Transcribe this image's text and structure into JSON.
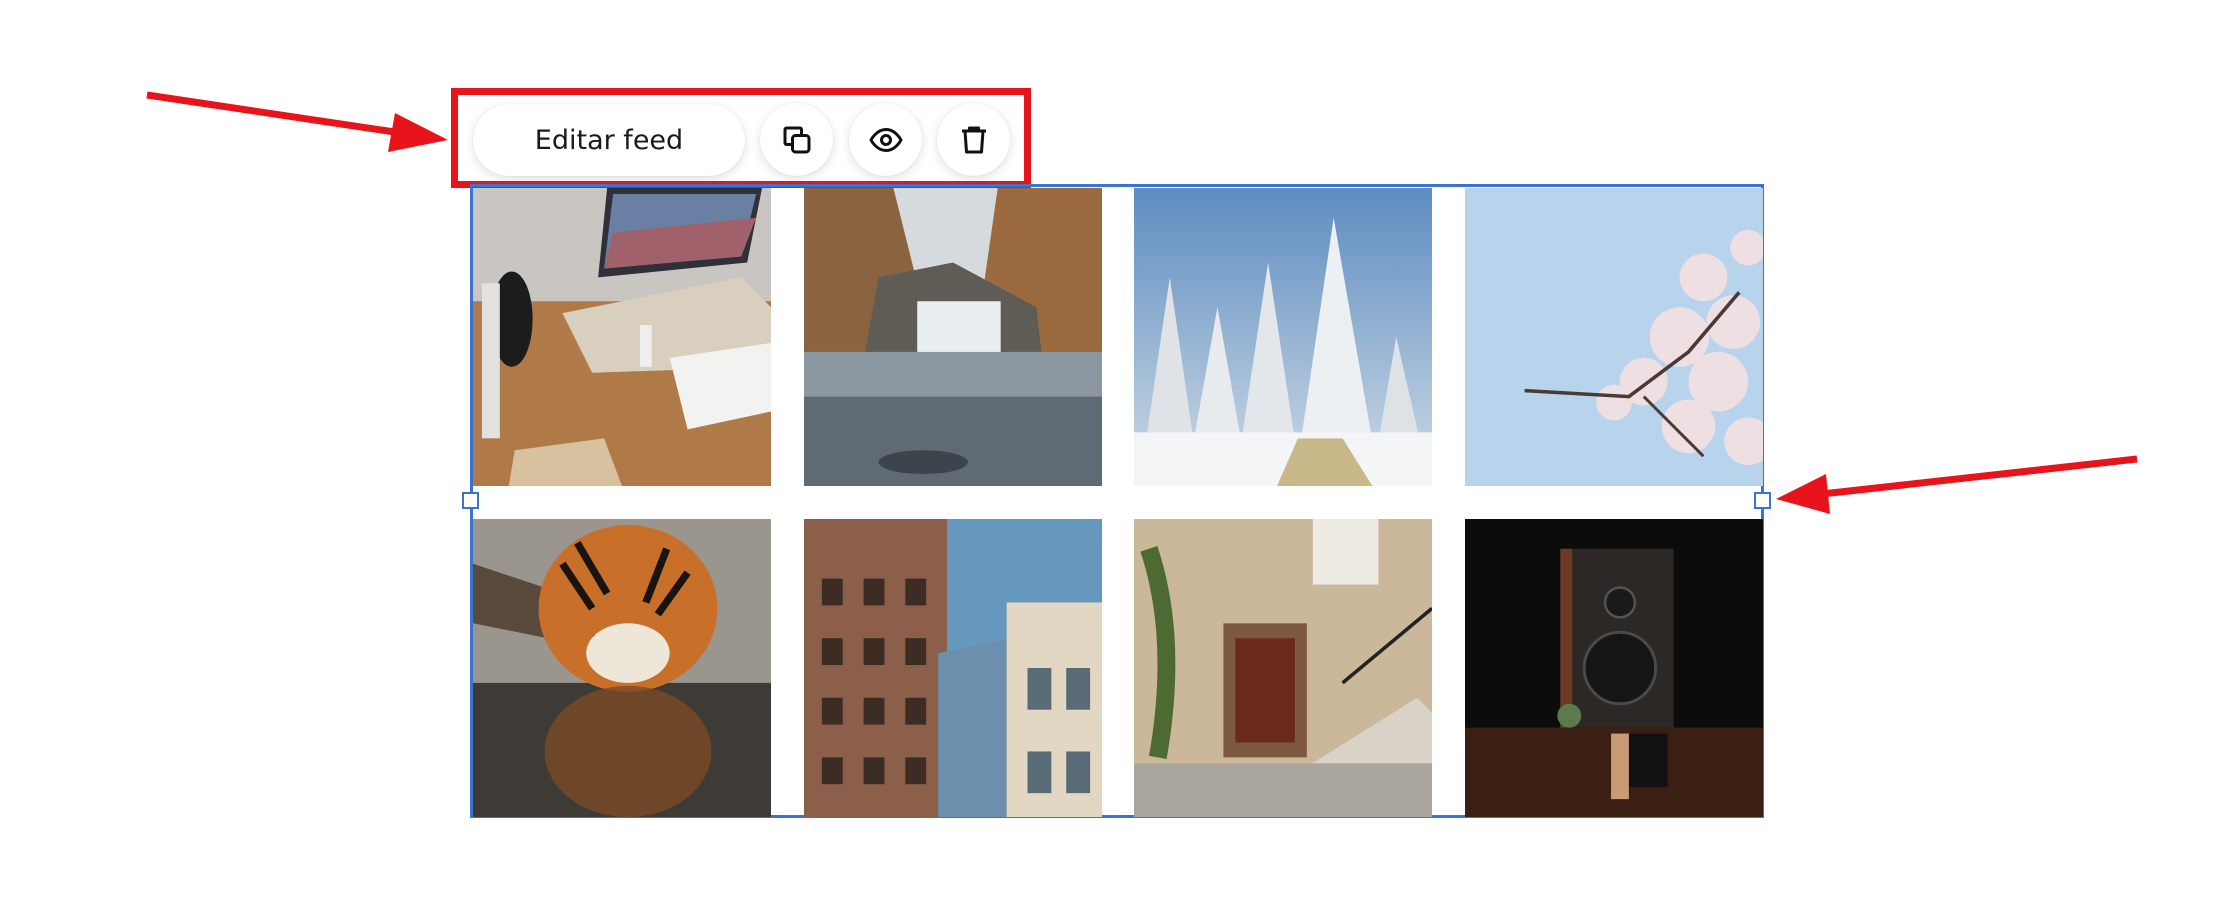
{
  "toolbar": {
    "edit_label": "Editar feed",
    "icons": [
      "duplicate-icon",
      "eye-icon",
      "trash-icon"
    ]
  },
  "gallery": {
    "photos": [
      "laptop-desk-photo",
      "waterfall-photo",
      "snowy-pines-photo",
      "cherry-blossom-photo",
      "tiger-photo",
      "city-buildings-photo",
      "stone-house-photo",
      "speaker-photo"
    ]
  },
  "colors": {
    "annotation": "#e8141b",
    "selection": "#3b73d4"
  }
}
